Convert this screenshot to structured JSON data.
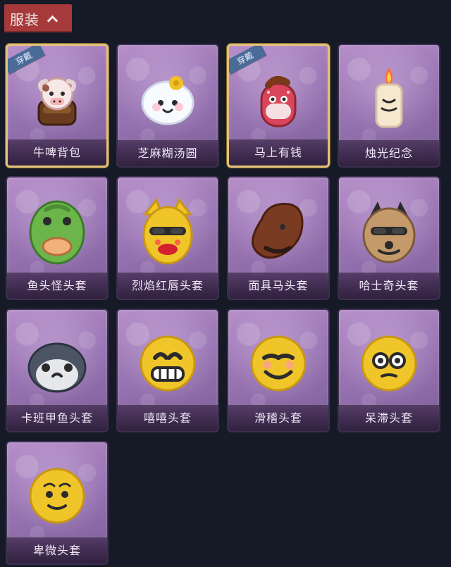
{
  "header": {
    "title": "服装"
  },
  "items": [
    {
      "name": "牛啤背包",
      "worn": true,
      "badge": "穿戴",
      "icon": "cow-beer-backpack-icon"
    },
    {
      "name": "芝麻糊汤圆",
      "worn": false,
      "badge": "",
      "icon": "rice-ball-icon"
    },
    {
      "name": "马上有钱",
      "worn": true,
      "badge": "穿戴",
      "icon": "horse-rich-icon"
    },
    {
      "name": "烛光纪念",
      "worn": false,
      "badge": "",
      "icon": "candle-icon"
    },
    {
      "name": "鱼头怪头套",
      "worn": false,
      "badge": "",
      "icon": "fish-head-mask-icon"
    },
    {
      "name": "烈焰红唇头套",
      "worn": false,
      "badge": "",
      "icon": "pikachu-lips-mask-icon"
    },
    {
      "name": "面具马头套",
      "worn": false,
      "badge": "",
      "icon": "horse-mask-icon"
    },
    {
      "name": "哈士奇头套",
      "worn": false,
      "badge": "",
      "icon": "husky-mask-icon"
    },
    {
      "name": "卡班甲鱼头套",
      "worn": false,
      "badge": "",
      "icon": "turtle-mask-icon"
    },
    {
      "name": "嘻嘻头套",
      "worn": false,
      "badge": "",
      "icon": "grin-emoji-mask-icon"
    },
    {
      "name": "滑稽头套",
      "worn": false,
      "badge": "",
      "icon": "smirk-emoji-mask-icon"
    },
    {
      "name": "呆滞头套",
      "worn": false,
      "badge": "",
      "icon": "stare-emoji-mask-icon"
    },
    {
      "name": "卑微头套",
      "worn": false,
      "badge": "",
      "icon": "humble-emoji-mask-icon"
    }
  ]
}
